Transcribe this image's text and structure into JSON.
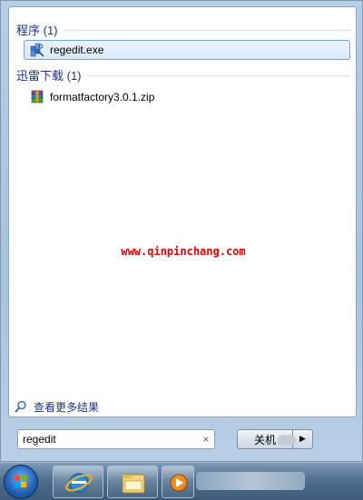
{
  "results": {
    "groups": [
      {
        "title": "程序 (1)",
        "items": [
          {
            "label": "regedit.exe",
            "icon": "registry-editor-icon"
          }
        ]
      },
      {
        "title": "迅雷下载 (1)",
        "items": [
          {
            "label": "formatfactory3.0.1.zip",
            "icon": "zip-archive-icon"
          }
        ]
      }
    ],
    "watermark": "www.qinpinchang.com",
    "see_more": "查看更多结果"
  },
  "search": {
    "value": "regedit",
    "clear_symbol": "×"
  },
  "shutdown": {
    "label": "关机",
    "arrow": "▶"
  },
  "taskbar": {
    "pinned": [
      "internet-explorer-icon",
      "file-explorer-icon",
      "media-player-icon"
    ]
  }
}
